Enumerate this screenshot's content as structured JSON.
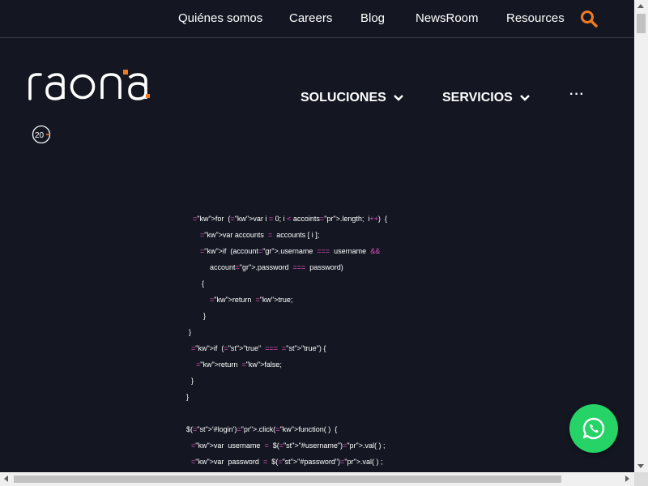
{
  "topnav": {
    "items": [
      {
        "label": "Quiénes somos",
        "name": "topnav-quienes-somos"
      },
      {
        "label": "Careers",
        "name": "topnav-careers"
      },
      {
        "label": "Blog",
        "name": "topnav-blog"
      },
      {
        "label": "NewsRoom",
        "name": "topnav-newsroom"
      },
      {
        "label": "Resources",
        "name": "topnav-resources"
      }
    ],
    "search_icon": "search-icon"
  },
  "brand": {
    "logo_text": "raona",
    "badge_text": "20"
  },
  "mainnav": {
    "soluciones": "SOLUCIONES",
    "servicios": "SERVICIOS",
    "more": "···"
  },
  "code_lines": [
    "for  (var i = 0; i < accoints.length;  i++)  {",
    "var accounts  =  accounts [ i ];",
    "if  (account.username  ===  username  &&",
    "account.password  ===  password)",
    "{",
    "return  true;",
    "}",
    "}",
    "if  (\"true\"  ===  \"true\") {",
    "return  false;",
    "}",
    "}",
    "$('#login').click(function( )  {",
    "var  username  =  $(\"#username\").val( ) ;",
    "var  password  =  $(\"#password\").val( ) ;"
  ],
  "colors": {
    "background": "#141722",
    "accent_orange": "#f07a22",
    "keyword_pink": "#e455c4",
    "property_blue": "#4fb3ff",
    "value_green": "#4ccd6b",
    "string_yellow": "#ffd97a",
    "whatsapp_green": "#25d366"
  },
  "whatsapp": {
    "icon": "whatsapp-icon"
  }
}
